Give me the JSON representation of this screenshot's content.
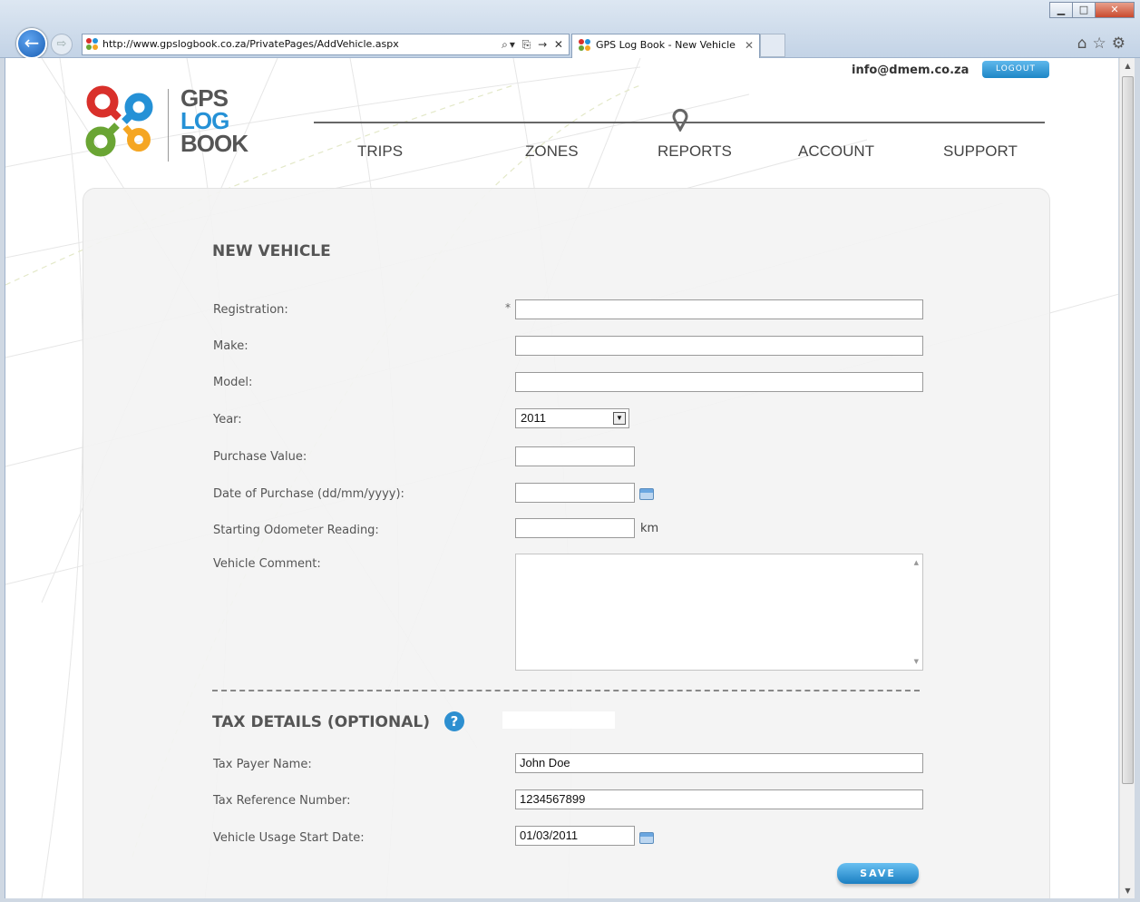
{
  "browser": {
    "url": "http://www.gpslogbook.co.za/PrivatePages/AddVehicle.aspx",
    "tab_title": "GPS Log Book - New Vehicle",
    "tab_close": "✕",
    "window_controls": {
      "minimize": "▁",
      "maximize": "□",
      "close": "✕"
    },
    "back_glyph": "←",
    "forward_glyph": "⇨",
    "addr_tools": "⌕▾ ⎘ → ✕",
    "toolbar_icons": "⌂☆⚙"
  },
  "header": {
    "user_email": "info@dmem.co.za",
    "logout_label": "LOGOUT",
    "logo_line1": "GPS",
    "logo_line2": "LOG",
    "logo_line3": "BOOK",
    "nav": [
      "TRIPS",
      "ZONES",
      "REPORTS",
      "ACCOUNT",
      "SUPPORT"
    ]
  },
  "form": {
    "title": "NEW VEHICLE",
    "required_mark": "*",
    "fields": {
      "registration": {
        "label": "Registration:",
        "value": ""
      },
      "make": {
        "label": "Make:",
        "value": ""
      },
      "model": {
        "label": "Model:",
        "value": ""
      },
      "year": {
        "label": "Year:",
        "value": "2011"
      },
      "purchase_value": {
        "label": "Purchase Value:",
        "value": ""
      },
      "purchase_date": {
        "label": "Date of Purchase (dd/mm/yyyy):",
        "value": ""
      },
      "odometer": {
        "label": "Starting Odometer Reading:",
        "value": "",
        "unit": "km"
      },
      "comment": {
        "label": "Vehicle Comment:",
        "value": ""
      }
    }
  },
  "tax": {
    "title": "TAX DETAILS (OPTIONAL)",
    "help_glyph": "?",
    "fields": {
      "payer_name": {
        "label": "Tax Payer Name:",
        "value": "John Doe"
      },
      "reference_number": {
        "label": "Tax Reference Number:",
        "value": "1234567899"
      },
      "usage_start": {
        "label": "Vehicle Usage Start Date:",
        "value": "01/03/2011"
      }
    }
  },
  "save_label": "SAVE",
  "colors": {
    "accent": "#1d86c6",
    "logo_red": "#d9302b",
    "logo_blue": "#2591d6",
    "logo_green": "#6aa534",
    "logo_orange": "#f5a623"
  }
}
